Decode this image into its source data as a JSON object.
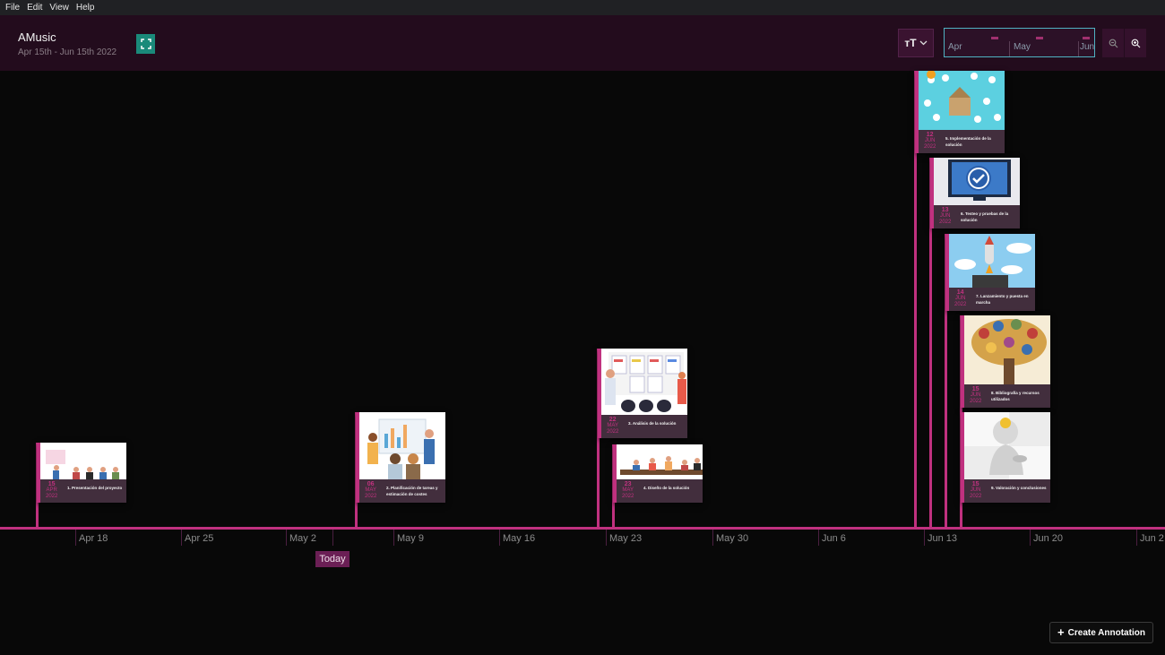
{
  "menu": [
    "File",
    "Edit",
    "View",
    "Help"
  ],
  "header": {
    "title": "AMusic",
    "range": "Apr 15th - Jun 15th 2022",
    "text_size_label": "тT"
  },
  "minimap": {
    "months": [
      "Apr",
      "May",
      "Jun"
    ]
  },
  "axis": {
    "ticks": [
      "Apr 18",
      "Apr 25",
      "May 2",
      "May 9",
      "May 16",
      "May 23",
      "May 30",
      "Jun 6",
      "Jun 13",
      "Jun 20",
      "Jun 2"
    ],
    "today_label": "Today"
  },
  "events": [
    {
      "day": "15",
      "month": "APR",
      "year": "2022",
      "title": "1. Presentación del proyecto"
    },
    {
      "day": "06",
      "month": "MAY",
      "year": "2022",
      "title": "2. Planificación de tareas y estimación de costes"
    },
    {
      "day": "22",
      "month": "MAY",
      "year": "2022",
      "title": "3. Análisis de la solución"
    },
    {
      "day": "23",
      "month": "MAY",
      "year": "2022",
      "title": "4. Diseño de la solución"
    },
    {
      "day": "12",
      "month": "JUN",
      "year": "2022",
      "title": "5. Implementación de la solución"
    },
    {
      "day": "13",
      "month": "JUN",
      "year": "2022",
      "title": "6. Testeo y pruebas de la solución"
    },
    {
      "day": "14",
      "month": "JUN",
      "year": "2022",
      "title": "7. Lanzamiento y puesta en marcha"
    },
    {
      "day": "15",
      "month": "JUN",
      "year": "2022",
      "title": "8. Bibliografía y recursos utilizados"
    },
    {
      "day": "15",
      "month": "JUN",
      "year": "2022",
      "title": "9. Valoración y conclusiones"
    }
  ],
  "actions": {
    "create_annotation": "Create Annotation"
  },
  "colors": {
    "accent": "#c0317f",
    "header_bg": "#230c1d",
    "teal": "#1a8a7a"
  }
}
